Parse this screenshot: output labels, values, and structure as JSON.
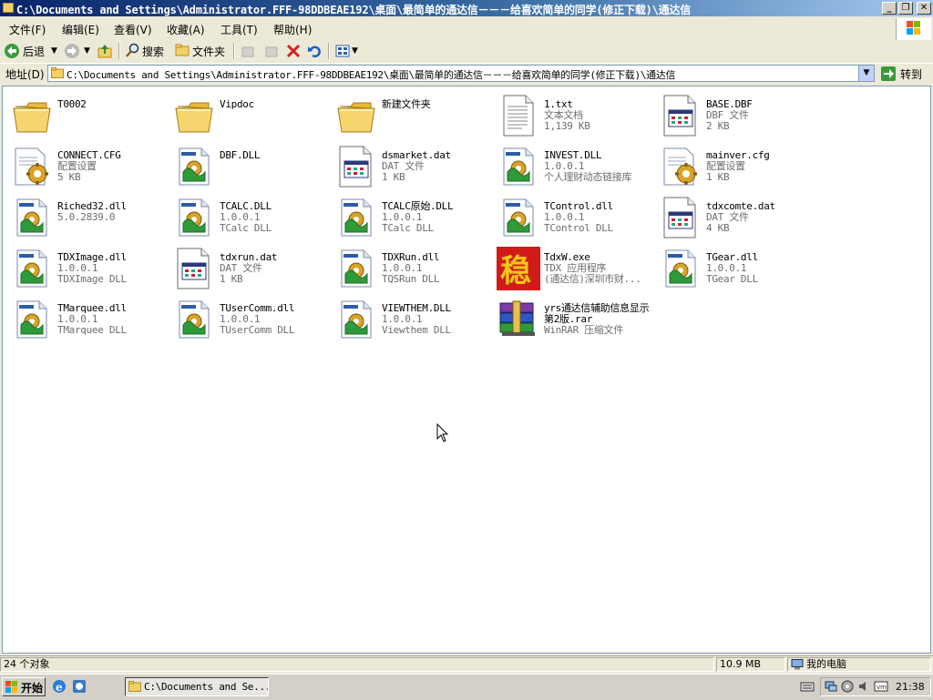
{
  "window": {
    "title": "C:\\Documents and Settings\\Administrator.FFF-98DDBEAE192\\桌面\\最简单的通达信－－－给喜欢简单的同学(修正下载)\\通达信",
    "min_label": "_",
    "max_label": "❐",
    "close_label": "✕"
  },
  "menu": [
    "文件(F)",
    "编辑(E)",
    "查看(V)",
    "收藏(A)",
    "工具(T)",
    "帮助(H)"
  ],
  "toolbar": {
    "back_label": "后退",
    "search_label": "搜索",
    "folders_label": "文件夹"
  },
  "address": {
    "label": "地址(D)",
    "value": "C:\\Documents and Settings\\Administrator.FFF-98DDBEAE192\\桌面\\最简单的通达信－－－给喜欢简单的同学(修正下载)\\通达信",
    "go_label": "转到"
  },
  "files": [
    {
      "name": "T0002",
      "line2": "",
      "line3": "",
      "icon": "folder-icon"
    },
    {
      "name": "Vipdoc",
      "line2": "",
      "line3": "",
      "icon": "folder-icon"
    },
    {
      "name": "新建文件夹",
      "line2": "",
      "line3": "",
      "icon": "folder-icon"
    },
    {
      "name": "1.txt",
      "line2": "文本文档",
      "line3": "1,139 KB",
      "icon": "text-document-icon"
    },
    {
      "name": "BASE.DBF",
      "line2": "DBF 文件",
      "line3": "2 KB",
      "icon": "generic-file-icon"
    },
    {
      "name": "CONNECT.CFG",
      "line2": "配置设置",
      "line3": "5 KB",
      "icon": "config-file-icon"
    },
    {
      "name": "DBF.DLL",
      "line2": "",
      "line3": "",
      "icon": "dll-icon"
    },
    {
      "name": "dsmarket.dat",
      "line2": "DAT 文件",
      "line3": "1 KB",
      "icon": "generic-file-icon"
    },
    {
      "name": "INVEST.DLL",
      "line2": "1.0.0.1",
      "line3": "个人理财动态链接库",
      "icon": "dll-icon"
    },
    {
      "name": "mainver.cfg",
      "line2": "配置设置",
      "line3": "1 KB",
      "icon": "config-file-icon"
    },
    {
      "name": "Riched32.dll",
      "line2": "5.0.2839.0",
      "line3": "",
      "icon": "dll-icon"
    },
    {
      "name": "TCALC.DLL",
      "line2": "1.0.0.1",
      "line3": "TCalc DLL",
      "icon": "dll-icon"
    },
    {
      "name": "TCALC原始.DLL",
      "line2": "1.0.0.1",
      "line3": "TCalc DLL",
      "icon": "dll-icon"
    },
    {
      "name": "TControl.dll",
      "line2": "1.0.0.1",
      "line3": "TControl DLL",
      "icon": "dll-icon"
    },
    {
      "name": "tdxcomte.dat",
      "line2": "DAT 文件",
      "line3": "4 KB",
      "icon": "generic-file-icon"
    },
    {
      "name": "TDXImage.dll",
      "line2": "1.0.0.1",
      "line3": "TDXImage DLL",
      "icon": "dll-icon"
    },
    {
      "name": "tdxrun.dat",
      "line2": "DAT 文件",
      "line3": "1 KB",
      "icon": "generic-file-icon"
    },
    {
      "name": "TDXRun.dll",
      "line2": "1.0.0.1",
      "line3": "TQSRun DLL",
      "icon": "dll-icon"
    },
    {
      "name": "TdxW.exe",
      "line2": "TDX 应用程序",
      "line3": "(通达信)深圳市财...",
      "icon": "tdx-app-icon"
    },
    {
      "name": "TGear.dll",
      "line2": "1.0.0.1",
      "line3": "TGear DLL",
      "icon": "dll-icon"
    },
    {
      "name": "TMarquee.dll",
      "line2": "1.0.0.1",
      "line3": "TMarquee DLL",
      "icon": "dll-icon"
    },
    {
      "name": "TUserComm.dll",
      "line2": "1.0.0.1",
      "line3": "TUserComm DLL",
      "icon": "dll-icon"
    },
    {
      "name": "VIEWTHEM.DLL",
      "line2": "1.0.0.1",
      "line3": "Viewthem DLL",
      "icon": "dll-icon"
    },
    {
      "name": "yrs通达信辅助信息显示 第2版.rar",
      "line2": "WinRAR 压缩文件",
      "line3": "",
      "icon": "rar-archive-icon"
    }
  ],
  "status": {
    "objects": "24 个对象",
    "size": "10.9 MB",
    "location": "我的电脑"
  },
  "taskbar": {
    "start_label": "开始",
    "task_label": "C:\\Documents and Se...",
    "clock": "21:38"
  },
  "colors": {
    "titlebar": "#0A246A",
    "window_face": "#ECE9D8",
    "dll_puzzle": "#2E9A3A"
  }
}
